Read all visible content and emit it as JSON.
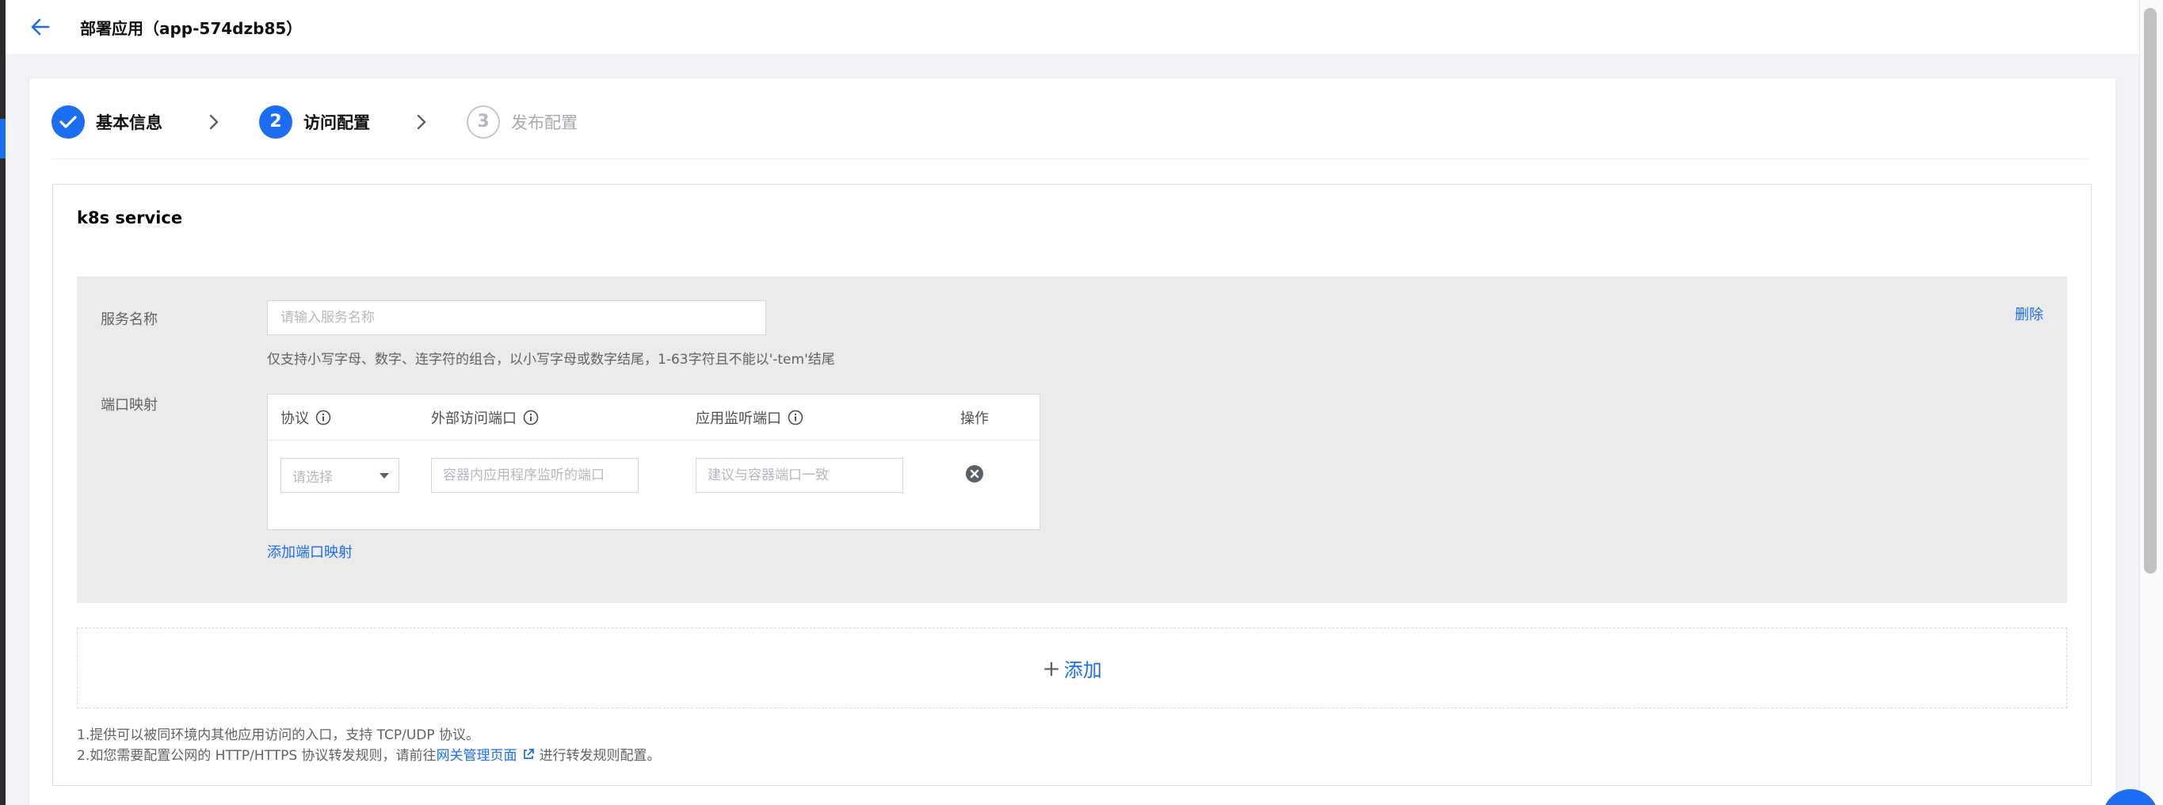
{
  "header": {
    "title": "部署应用（app-574dzb85）"
  },
  "steps": [
    {
      "number": "1",
      "label": "基本信息",
      "state": "done"
    },
    {
      "number": "2",
      "label": "访问配置",
      "state": "active"
    },
    {
      "number": "3",
      "label": "发布配置",
      "state": "pending"
    }
  ],
  "section": {
    "title": "k8s service",
    "service": {
      "name_label": "服务名称",
      "name_placeholder": "请输入服务名称",
      "name_hint": "仅支持小写字母、数字、连字符的组合，以小写字母或数字结尾，1-63字符且不能以'-tem'结尾",
      "delete_label": "删除",
      "port_label": "端口映射",
      "port_table": {
        "headers": [
          "协议",
          "外部访问端口",
          "应用监听端口",
          "操作"
        ],
        "row": {
          "protocol_placeholder": "请选择",
          "external_port_placeholder": "容器内应用程序监听的端口",
          "listen_port_placeholder": "建议与容器端口一致"
        }
      },
      "add_port_label": "添加端口映射"
    },
    "add_label": "添加",
    "add_plus": "+",
    "notes": {
      "line1": "1.提供可以被同环境内其他应用访问的入口，支持 TCP/UDP 协议。",
      "line2_prefix": "2.如您需要配置公网的 HTTP/HTTPS 协议转发规则，请前往",
      "line2_link": "网关管理页面",
      "line2_suffix": "进行转发规则配置。"
    }
  },
  "colors": {
    "accent": "#1b6ef3",
    "block_bg": "#ebebeb",
    "page_bg": "#f2f3f7"
  },
  "icons": [
    "back-arrow-icon",
    "check-icon",
    "chevron-right-icon",
    "info-icon",
    "close-circle-icon",
    "caret-down-icon",
    "external-link-icon"
  ]
}
